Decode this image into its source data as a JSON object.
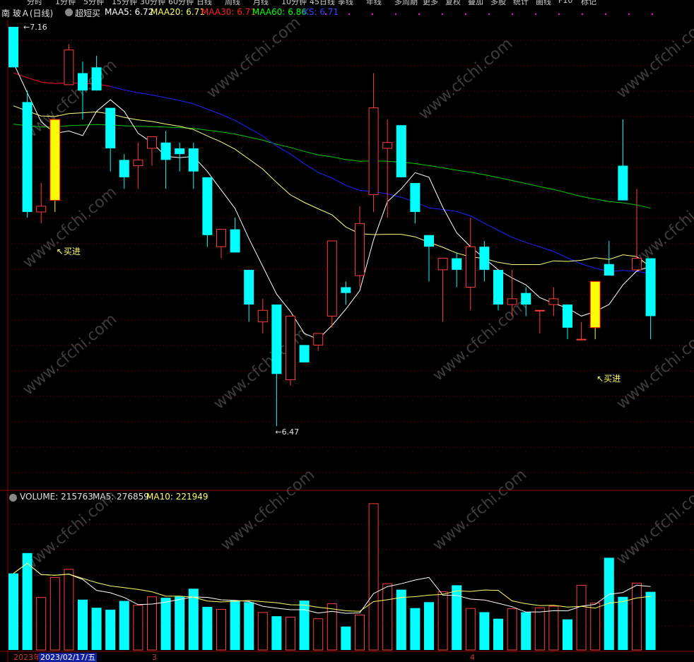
{
  "toolbar": {
    "tabs": [
      "分时",
      "1分钟",
      "5分钟",
      "15分钟",
      "30分钟",
      "60分钟",
      "日线",
      "周线",
      "月线",
      "10分钟",
      "45日线",
      "季线",
      "年线",
      "多周期",
      "更多",
      "复权",
      "叠加",
      "多股",
      "统计",
      "画线",
      "F10",
      "标记"
    ]
  },
  "main_header": {
    "stock": "南 玻Ａ(日线)",
    "indicator": "超短买",
    "ma5": "MAA5: 6.72",
    "ma20": "MAA20: 6.71",
    "ma30": "MAA30: 6.71",
    "ma60": "MAA60: 6.86",
    "ks": "KS: 6.71"
  },
  "annotations": {
    "high": "7.16",
    "low": "6.47",
    "buy1": "↖买进",
    "buy2": "↖买进"
  },
  "volume_header": {
    "volume": "VOLUME: 215763",
    "ma5": "MA5: 276859",
    "ma10": "MA10: 221949"
  },
  "date_axis": {
    "year": "2023年",
    "cursor": "2023/02/17/五",
    "m3": "3",
    "m4": "4"
  },
  "watermark": "www.cfchi.com",
  "colors": {
    "up": "#ff3c3c",
    "down": "#00ffff",
    "signal": "#ffff00",
    "ma5": "#ffffff",
    "ma20": "#ffff80",
    "ma30": "#ff0000",
    "ma60": "#00cc00",
    "ks": "#2222ff",
    "grid": "#8b0000"
  },
  "chart_data": {
    "type": "candlestick",
    "price_range": [
      6.4,
      7.2
    ],
    "candles": [
      {
        "o": 7.16,
        "h": 7.16,
        "l": 7.09,
        "c": 7.09
      },
      {
        "o": 7.03,
        "h": 7.05,
        "l": 6.83,
        "c": 6.84
      },
      {
        "o": 6.84,
        "h": 6.89,
        "l": 6.82,
        "c": 6.85
      },
      {
        "o": 6.86,
        "h": 7.0,
        "l": 6.84,
        "c": 7.0
      },
      {
        "o": 7.06,
        "h": 7.13,
        "l": 7.06,
        "c": 7.12
      },
      {
        "o": 7.08,
        "h": 7.1,
        "l": 7.0,
        "c": 7.05
      },
      {
        "o": 7.09,
        "h": 7.11,
        "l": 7.05,
        "c": 7.05
      },
      {
        "o": 7.02,
        "h": 7.02,
        "l": 6.91,
        "c": 6.95
      },
      {
        "o": 6.93,
        "h": 6.94,
        "l": 6.88,
        "c": 6.9
      },
      {
        "o": 6.92,
        "h": 6.96,
        "l": 6.88,
        "c": 6.93
      },
      {
        "o": 6.95,
        "h": 6.97,
        "l": 6.92,
        "c": 6.97
      },
      {
        "o": 6.96,
        "h": 6.98,
        "l": 6.88,
        "c": 6.93
      },
      {
        "o": 6.95,
        "h": 6.96,
        "l": 6.91,
        "c": 6.94
      },
      {
        "o": 6.95,
        "h": 6.96,
        "l": 6.88,
        "c": 6.91
      },
      {
        "o": 6.9,
        "h": 6.9,
        "l": 6.78,
        "c": 6.8
      },
      {
        "o": 6.78,
        "h": 6.81,
        "l": 6.76,
        "c": 6.81
      },
      {
        "o": 6.81,
        "h": 6.83,
        "l": 6.77,
        "c": 6.77
      },
      {
        "o": 6.74,
        "h": 6.74,
        "l": 6.65,
        "c": 6.68
      },
      {
        "o": 6.65,
        "h": 6.69,
        "l": 6.63,
        "c": 6.67
      },
      {
        "o": 6.68,
        "h": 6.68,
        "l": 6.47,
        "c": 6.56
      },
      {
        "o": 6.55,
        "h": 6.66,
        "l": 6.54,
        "c": 6.66
      },
      {
        "o": 6.61,
        "h": 6.61,
        "l": 6.58,
        "c": 6.58
      },
      {
        "o": 6.61,
        "h": 6.63,
        "l": 6.6,
        "c": 6.63
      },
      {
        "o": 6.66,
        "h": 6.79,
        "l": 6.64,
        "c": 6.79
      },
      {
        "o": 6.71,
        "h": 6.72,
        "l": 6.68,
        "c": 6.7
      },
      {
        "o": 6.73,
        "h": 6.85,
        "l": 6.71,
        "c": 6.82
      },
      {
        "o": 6.87,
        "h": 7.08,
        "l": 6.84,
        "c": 7.02
      },
      {
        "o": 6.95,
        "h": 7.0,
        "l": 6.83,
        "c": 6.96
      },
      {
        "o": 6.99,
        "h": 6.99,
        "l": 6.9,
        "c": 6.9
      },
      {
        "o": 6.89,
        "h": 6.89,
        "l": 6.82,
        "c": 6.84
      },
      {
        "o": 6.8,
        "h": 6.8,
        "l": 6.72,
        "c": 6.78
      },
      {
        "o": 6.74,
        "h": 6.74,
        "l": 6.65,
        "c": 6.76
      },
      {
        "o": 6.76,
        "h": 6.77,
        "l": 6.71,
        "c": 6.74
      },
      {
        "o": 6.71,
        "h": 6.83,
        "l": 6.67,
        "c": 6.78
      },
      {
        "o": 6.78,
        "h": 6.79,
        "l": 6.72,
        "c": 6.74
      },
      {
        "o": 6.74,
        "h": 6.74,
        "l": 6.67,
        "c": 6.68
      },
      {
        "o": 6.68,
        "h": 6.74,
        "l": 6.66,
        "c": 6.69
      },
      {
        "o": 6.7,
        "h": 6.71,
        "l": 6.66,
        "c": 6.68
      },
      {
        "o": 6.67,
        "h": 6.67,
        "l": 6.63,
        "c": 6.67
      },
      {
        "o": 6.68,
        "h": 6.71,
        "l": 6.66,
        "c": 6.69
      },
      {
        "o": 6.68,
        "h": 6.68,
        "l": 6.62,
        "c": 6.64
      },
      {
        "o": 6.62,
        "h": 6.65,
        "l": 6.62,
        "c": 6.62
      },
      {
        "o": 6.64,
        "h": 6.64,
        "l": 6.62,
        "c": 6.72
      },
      {
        "o": 6.75,
        "h": 6.79,
        "l": 6.74,
        "c": 6.73
      },
      {
        "o": 6.92,
        "h": 7.0,
        "l": 6.87,
        "c": 6.86
      },
      {
        "o": 6.74,
        "h": 6.88,
        "l": 6.75,
        "c": 6.76
      },
      {
        "o": 6.76,
        "h": 6.76,
        "l": 6.62,
        "c": 6.66
      }
    ],
    "signal_candles": [
      3,
      42
    ],
    "volumes": [
      245000,
      310000,
      168000,
      232000,
      258000,
      161000,
      135000,
      129000,
      157000,
      143000,
      170000,
      167000,
      171000,
      196000,
      138000,
      130000,
      158000,
      153000,
      120000,
      108000,
      105000,
      158000,
      100000,
      148000,
      75000,
      112000,
      468000,
      212000,
      193000,
      134000,
      153000,
      186000,
      207000,
      133000,
      121000,
      100000,
      132000,
      121000,
      135000,
      140000,
      98000,
      207000,
      150000,
      295000,
      170000,
      214000,
      186000
    ],
    "volume_range": [
      0,
      470000
    ]
  }
}
